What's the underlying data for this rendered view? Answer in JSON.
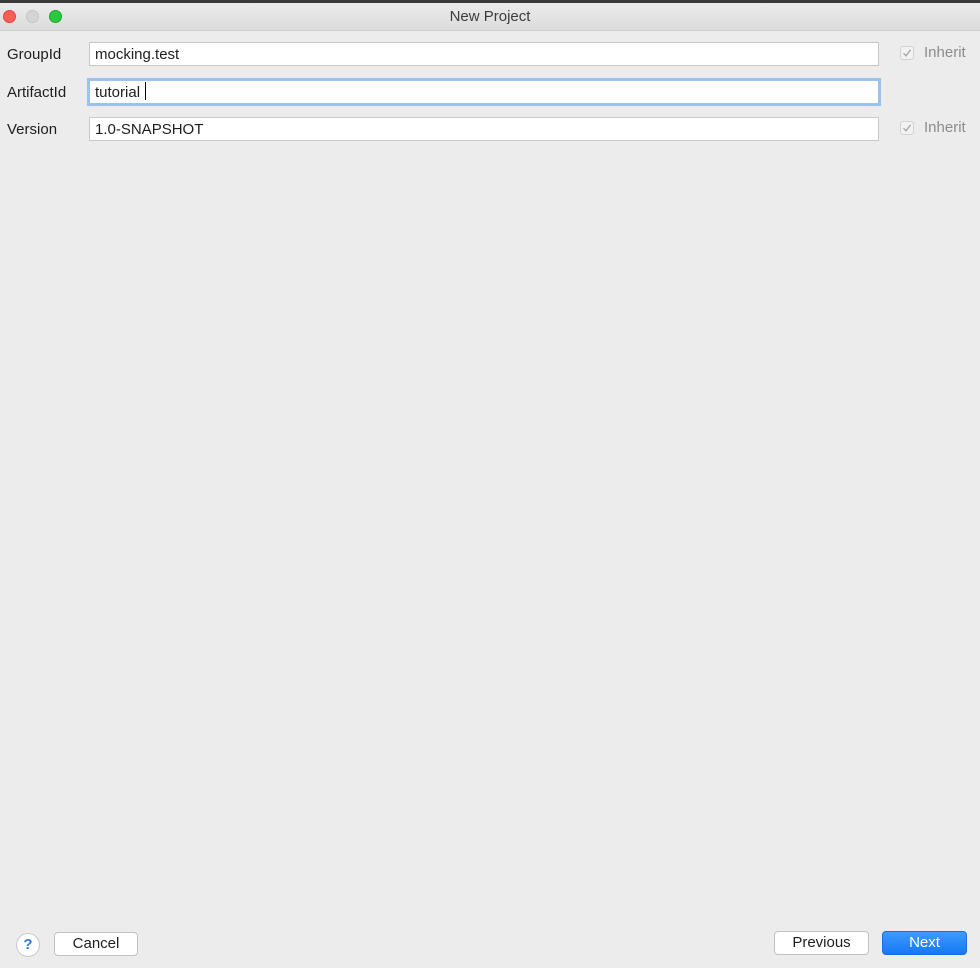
{
  "window": {
    "title": "New Project"
  },
  "form": {
    "group_id": {
      "label": "GroupId",
      "value": "mocking.test",
      "inherit_label": "Inherit",
      "inherit_checked": true
    },
    "artifact_id": {
      "label": "ArtifactId",
      "value": "tutorial"
    },
    "version": {
      "label": "Version",
      "value": "1.0-SNAPSHOT",
      "inherit_label": "Inherit",
      "inherit_checked": true
    }
  },
  "footer": {
    "help_label": "?",
    "cancel_label": "Cancel",
    "previous_label": "Previous",
    "next_label": "Next"
  },
  "colors": {
    "accent": "#1578f5",
    "focus_ring": "#9cc2ef",
    "background": "#ececec"
  }
}
